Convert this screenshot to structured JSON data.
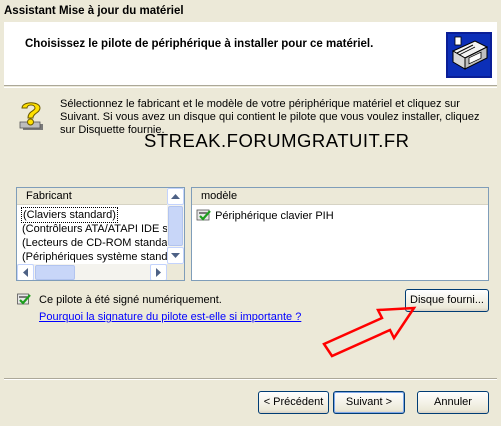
{
  "window": {
    "title": "Assistant Mise à jour du matériel"
  },
  "header": {
    "title": "Choisissez le pilote de périphérique à installer pour ce matériel."
  },
  "instructions": {
    "text": "Sélectionnez le fabricant et le modèle de votre périphérique matériel et cliquez sur Suivant. Si vous avez un disque qui contient le pilote que vous voulez installer, cliquez sur Disquette fournie."
  },
  "watermark": {
    "text": "STREAK.FORUMGRATUIT.FR"
  },
  "manufacturer_list": {
    "header": "Fabricant",
    "items": [
      "(Claviers standard)",
      "(Contrôleurs ATA/ATAPI IDE s",
      "(Lecteurs de CD-ROM standar",
      "(Périphériques système standa"
    ],
    "selected_index": 0
  },
  "model_list": {
    "header": "modèle",
    "items": [
      "Périphérique clavier PIH"
    ]
  },
  "signature": {
    "text": "Ce pilote à été signé numériquement.",
    "link": "Pourquoi la signature du pilote est-elle si importante ?"
  },
  "buttons": {
    "have_disk": "Disque fourni...",
    "back": "< Précédent",
    "next": "Suivant >",
    "cancel": "Annuler"
  },
  "colors": {
    "dialog_bg": "#ece9d8",
    "link": "#0000ff",
    "arrow": "#ff0000",
    "list_border": "#7f9db9"
  },
  "icons": [
    "hardware-card-icon",
    "help-question-icon",
    "driver-signed-icon",
    "scroll-up-arrow-icon",
    "scroll-down-arrow-icon",
    "scroll-left-arrow-icon",
    "scroll-right-arrow-icon"
  ]
}
